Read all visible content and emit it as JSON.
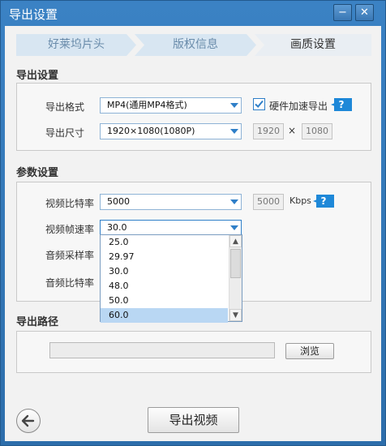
{
  "window": {
    "title": "导出设置",
    "minimize": "−",
    "close": "✕"
  },
  "steps": [
    {
      "label": "好莱坞片头"
    },
    {
      "label": "版权信息"
    },
    {
      "label": "画质设置"
    }
  ],
  "export_settings": {
    "title": "导出设置",
    "format_label": "导出格式",
    "format_value": "MP4(通用MP4格式)",
    "hw_accel_checked": true,
    "hw_accel_label": "硬件加速导出",
    "help": "?",
    "size_label": "导出尺寸",
    "size_value": "1920×1080(1080P)",
    "width": "1920",
    "times": "×",
    "height": "1080"
  },
  "param_settings": {
    "title": "参数设置",
    "video_bitrate_label": "视频比特率",
    "video_bitrate_value": "5000",
    "video_bitrate_num": "5000",
    "unit": "Kbps",
    "help": "?",
    "framerate_label": "视频帧速率",
    "framerate_value": "30.0",
    "sample_rate_label": "音频采样率",
    "audio_bitrate_label": "音频比特率",
    "framerate_options": [
      "25.0",
      "29.97",
      "30.0",
      "48.0",
      "50.0",
      "60.0"
    ],
    "framerate_highlighted": "60.0"
  },
  "export_path": {
    "title": "导出路径",
    "value": "",
    "browse_label": "浏览"
  },
  "footer": {
    "export_label": "导出视频"
  },
  "icons": {
    "back": "arrow-left-icon",
    "check": "check-icon",
    "scroll_up": "chevron-up-icon",
    "scroll_down": "chevron-down-icon"
  },
  "colors": {
    "titlebar": "#3b82c4",
    "accent": "#1e88d8",
    "highlight": "#b9d7f3"
  }
}
